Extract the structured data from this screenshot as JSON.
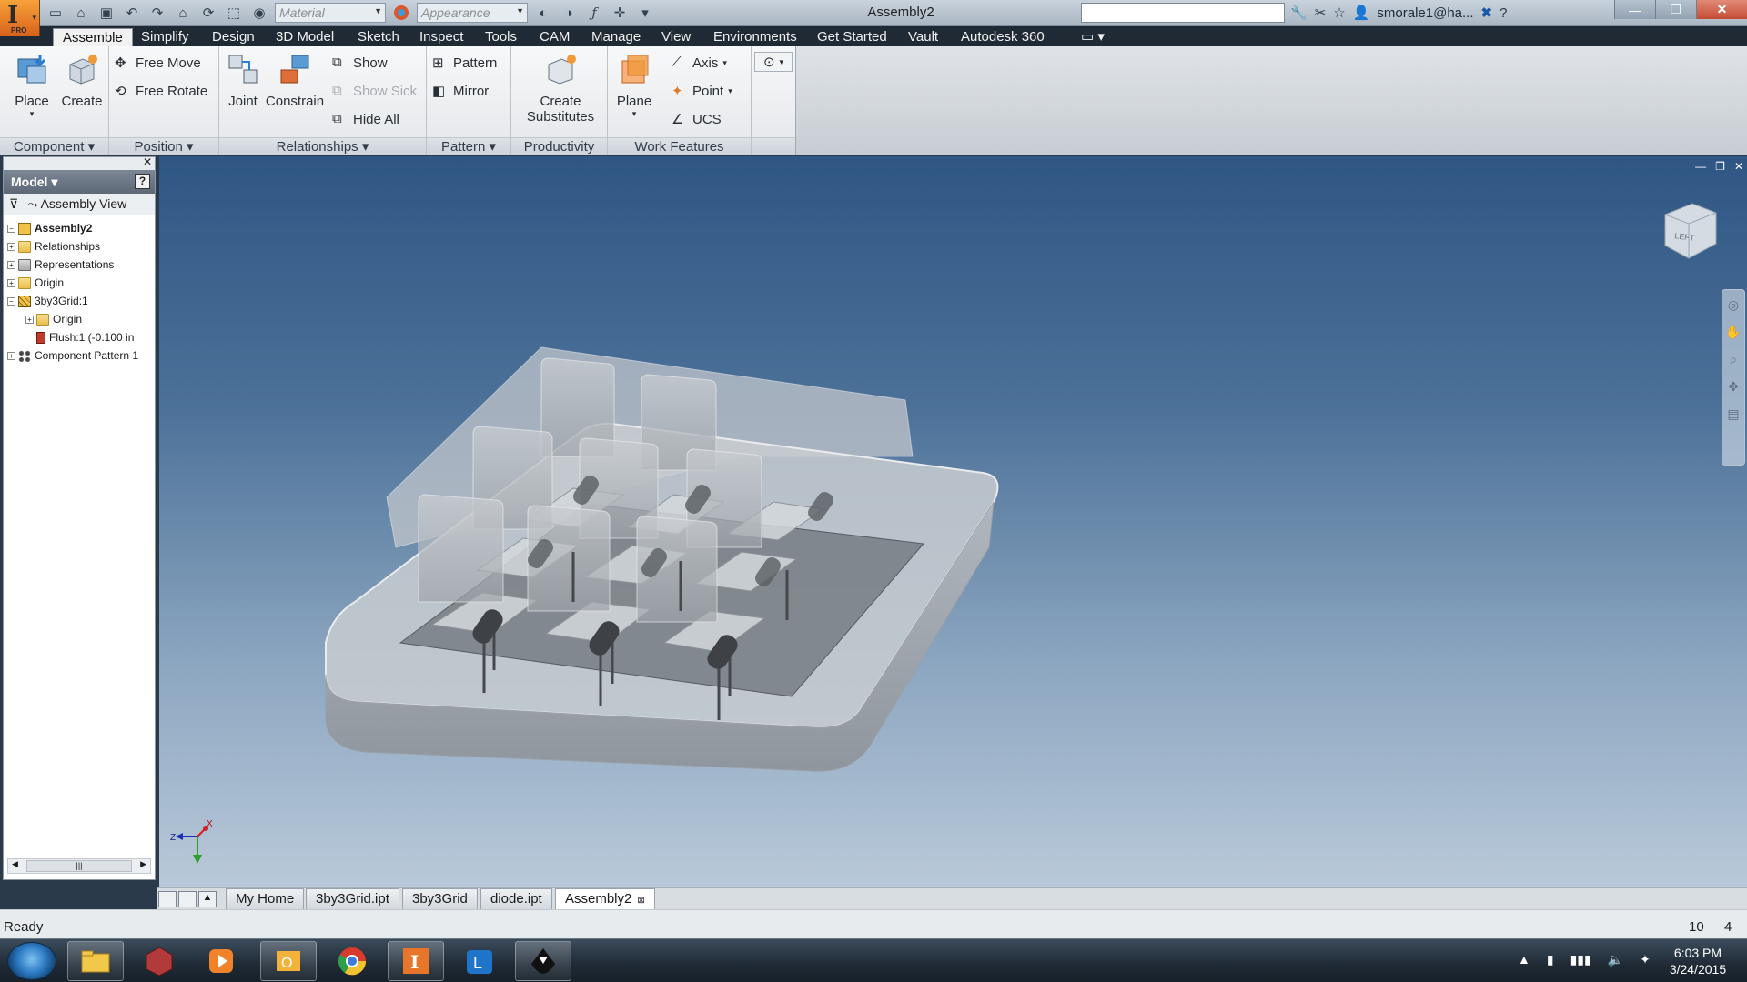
{
  "app": {
    "window_title": "Assembly2",
    "edition_badge": "PRO"
  },
  "quick_access": {
    "material_placeholder": "Material",
    "appearance_placeholder": "Appearance"
  },
  "account": {
    "user": "smorale1@ha..."
  },
  "tabs": [
    "Assemble",
    "Simplify",
    "Design",
    "3D Model",
    "Sketch",
    "Inspect",
    "Tools",
    "CAM",
    "Manage",
    "View",
    "Environments",
    "Get Started",
    "Vault",
    "Autodesk 360"
  ],
  "ribbon": {
    "component": {
      "label": "Component",
      "place": "Place",
      "create": "Create"
    },
    "position": {
      "label": "Position",
      "free_move": "Free Move",
      "free_rotate": "Free Rotate"
    },
    "relationships": {
      "label": "Relationships",
      "joint": "Joint",
      "constrain": "Constrain",
      "show": "Show",
      "show_sick": "Show Sick",
      "hide_all": "Hide All"
    },
    "pattern": {
      "label": "Pattern",
      "pattern": "Pattern",
      "mirror": "Mirror"
    },
    "productivity": {
      "label": "Productivity",
      "create_substitutes_1": "Create",
      "create_substitutes_2": "Substitutes"
    },
    "work_features": {
      "label": "Work Features",
      "plane": "Plane",
      "axis": "Axis",
      "point": "Point",
      "ucs": "UCS"
    }
  },
  "browser": {
    "title": "Model",
    "view_label": "Assembly View",
    "tree": [
      {
        "label": "Assembly2",
        "level": 0,
        "expander": "−",
        "icon": "assembly-icon",
        "bold": true
      },
      {
        "label": "Relationships",
        "level": 1,
        "expander": "+",
        "icon": "folder-icon"
      },
      {
        "label": "Representations",
        "level": 1,
        "expander": "+",
        "icon": "representations-icon"
      },
      {
        "label": "Origin",
        "level": 1,
        "expander": "+",
        "icon": "folder-icon"
      },
      {
        "label": "3by3Grid:1",
        "level": 1,
        "expander": "−",
        "icon": "part-icon"
      },
      {
        "label": "Origin",
        "level": 2,
        "expander": "+",
        "icon": "folder-icon"
      },
      {
        "label": "Flush:1 (-0.100 in",
        "level": 2,
        "expander": "",
        "icon": "constraint-icon"
      },
      {
        "label": "Component Pattern 1",
        "level": 1,
        "expander": "+",
        "icon": "pattern-icon"
      }
    ]
  },
  "viewcube": {
    "face_label": "LEFT"
  },
  "triad": {
    "x": "X",
    "z": "Z"
  },
  "doc_tabs": [
    {
      "label": "My Home",
      "active": false
    },
    {
      "label": "3by3Grid.ipt",
      "active": false
    },
    {
      "label": "3by3Grid",
      "active": false
    },
    {
      "label": "diode.ipt",
      "active": false
    },
    {
      "label": "Assembly2",
      "active": true
    }
  ],
  "status": {
    "text": "Ready",
    "count_1": "10",
    "count_2": "4"
  },
  "clock": {
    "time": "6:03 PM",
    "date": "3/24/2015"
  },
  "colors": {
    "accent_orange": "#f29a3a",
    "viewport_top": "#2f5684",
    "viewport_bottom": "#b9c9d9",
    "ribbon_tab_bar": "#202a34"
  }
}
